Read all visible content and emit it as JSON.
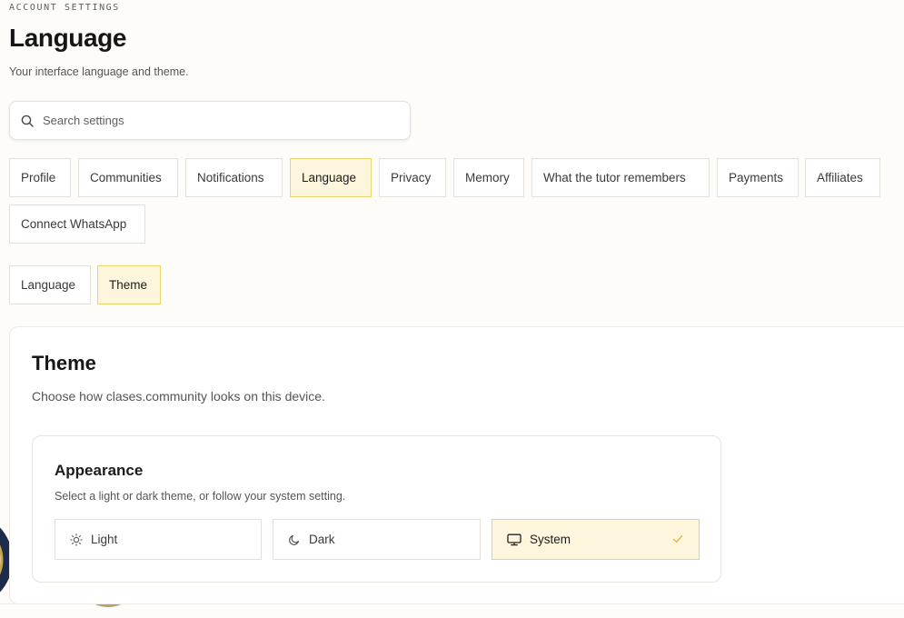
{
  "header": {
    "eyebrow": "ACCOUNT SETTINGS",
    "title": "Language",
    "subtitle": "Your interface language and theme."
  },
  "search": {
    "placeholder": "Search settings",
    "icon": "search-icon"
  },
  "tabs": [
    {
      "label": "Profile",
      "active": false
    },
    {
      "label": "Communities",
      "active": false
    },
    {
      "label": "Notifications",
      "active": false
    },
    {
      "label": "Language",
      "active": true
    },
    {
      "label": "Privacy",
      "active": false
    },
    {
      "label": "Memory",
      "active": false
    },
    {
      "label": "What the tutor remembers",
      "active": false
    },
    {
      "label": "Payments",
      "active": false
    },
    {
      "label": "Affiliates",
      "active": false
    },
    {
      "label": "Connect WhatsApp",
      "active": false
    }
  ],
  "subtabs": [
    {
      "label": "Language",
      "active": false
    },
    {
      "label": "Theme",
      "active": true
    }
  ],
  "theme_card": {
    "title": "Theme",
    "description": "Choose how clases.community looks on this device.",
    "appearance": {
      "title": "Appearance",
      "description": "Select a light or dark theme, or follow your system setting.",
      "options": [
        {
          "label": "Light",
          "icon": "sun-icon",
          "selected": false
        },
        {
          "label": "Dark",
          "icon": "moon-icon",
          "selected": false
        },
        {
          "label": "System",
          "icon": "monitor-icon",
          "selected": true
        }
      ]
    }
  },
  "colors": {
    "accent_bg": "#fdf6dd",
    "accent_border": "#eed46a",
    "check": "#e2b93b",
    "page_bg": "#fdfcf8"
  }
}
